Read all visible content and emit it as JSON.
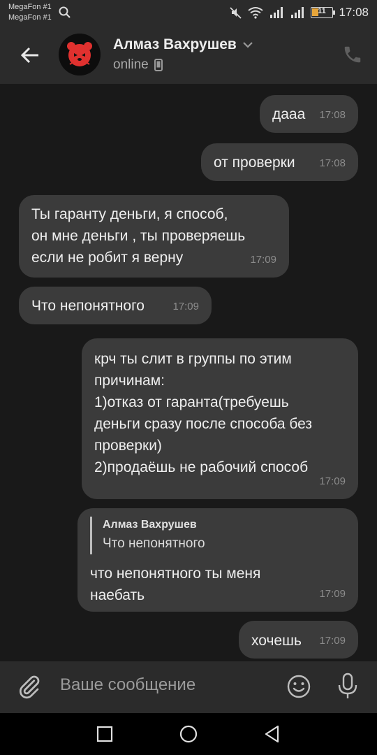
{
  "status_bar": {
    "carrier1": "MegaFon #1",
    "carrier2": "MegaFon #1",
    "battery": "11",
    "time": "17:08"
  },
  "header": {
    "contact_name": "Алмаз Вахрушев",
    "presence": "online"
  },
  "messages": [
    {
      "text": "дааа",
      "time": "17:08",
      "direction": "outgoing"
    },
    {
      "text": "от проверки",
      "time": "17:08",
      "direction": "outgoing"
    },
    {
      "lines": [
        "Ты гаранту деньги, я способ,",
        "он мне деньги , ты проверяешь",
        "если не робит я верну"
      ],
      "time": "17:09",
      "direction": "incoming"
    },
    {
      "text": "Что непонятного",
      "time": "17:09",
      "direction": "incoming"
    },
    {
      "lines": [
        "крч ты слит в группы по этим",
        "причинам:",
        "1)отказ от гаранта(требуешь",
        "деньги сразу после способа без",
        "проверки)",
        "2)продаёшь не рабочий способ"
      ],
      "time": "17:09",
      "direction": "outgoing"
    },
    {
      "reply_to": {
        "name": "Алмаз Вахрушев",
        "text": "Что непонятного"
      },
      "lines": [
        "что непонятного ты меня",
        "наебать"
      ],
      "time": "17:09",
      "direction": "outgoing"
    },
    {
      "text": "хочешь",
      "time": "17:09",
      "direction": "outgoing"
    }
  ],
  "composer": {
    "placeholder": "Ваше сообщение"
  },
  "icons": {
    "back": "arrow-left-icon",
    "call": "phone-icon",
    "attach": "paperclip-icon",
    "emoji": "smiley-icon",
    "voice": "microphone-icon",
    "nav_recents": "square-icon",
    "nav_home": "circle-icon",
    "nav_back": "triangle-back-icon"
  },
  "colors": {
    "background": "#191919",
    "bar": "#2b2b2b",
    "bubble": "#3b3b3b",
    "avatar_accent": "#e0312f"
  }
}
